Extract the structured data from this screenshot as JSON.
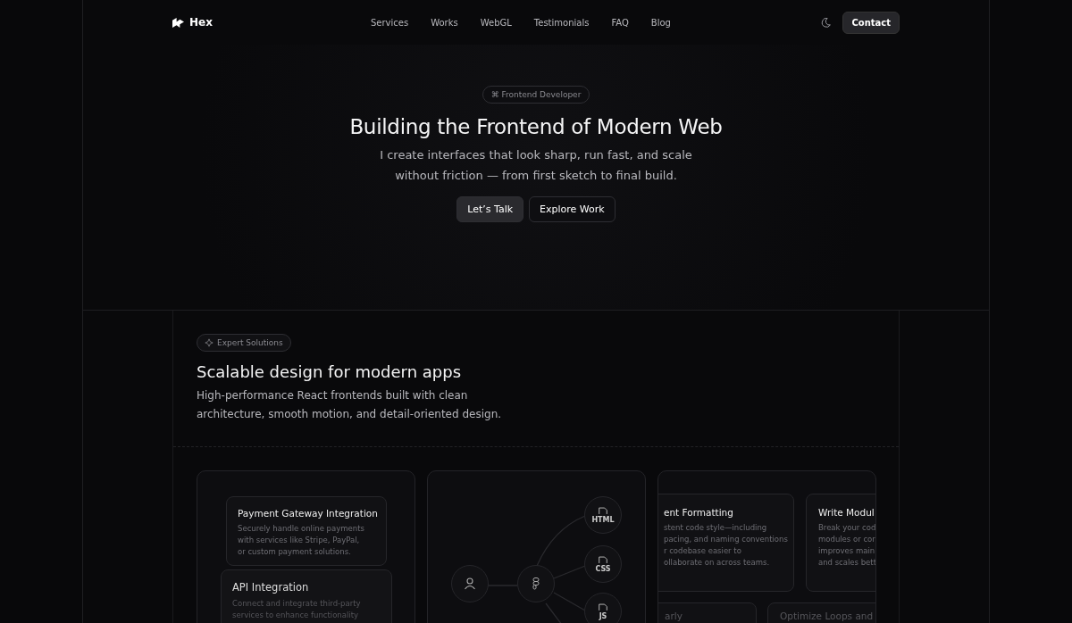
{
  "nav": {
    "brand": "Hex",
    "links": [
      "Services",
      "Works",
      "WebGL",
      "Testimonials",
      "FAQ",
      "Blog"
    ],
    "cta": "Contact"
  },
  "hero": {
    "badge": "⌘ Frontend Developer",
    "title": "Building the Frontend of Modern Web",
    "subtitle": [
      "I create interfaces that look sharp, run fast, and scale",
      "without friction — from first sketch to final build."
    ],
    "buttons": [
      {
        "label": "Let’s Talk",
        "kind": "primary"
      },
      {
        "label": "Explore Work",
        "kind": "secondary"
      }
    ]
  },
  "section": {
    "badge": "Expert Solutions",
    "title": "Scalable design for modern apps",
    "subtitle": [
      "High-performance React frontends built with clean",
      "architecture, smooth motion, and detail-oriented design."
    ]
  },
  "cards": [
    {
      "kind": "stack",
      "items": [
        {
          "title": "Payment Gateway Integration",
          "lines": [
            "Securely handle online payments",
            "with services like Stripe, PayPal,",
            "or custom payment solutions."
          ]
        },
        {
          "title": "API Integration",
          "lines": [
            "Connect and integrate third-party",
            "services to enhance functionality"
          ]
        }
      ]
    },
    {
      "kind": "diagram",
      "files": [
        "HTML",
        "CSS",
        "JS"
      ]
    },
    {
      "kind": "grid",
      "items": [
        {
          "title": "ent Formatting",
          "lines": [
            "stent code style—including",
            "pacing, and naming conventions",
            "r codebase easier to",
            "ollaborate on across teams."
          ]
        },
        {
          "title": "Write Modul",
          "lines": [
            "Break your cod",
            "modules or cor",
            "improves main",
            "and scales bett"
          ]
        },
        {
          "title": "arly"
        },
        {
          "title": "Optimize Loops and"
        }
      ]
    }
  ]
}
